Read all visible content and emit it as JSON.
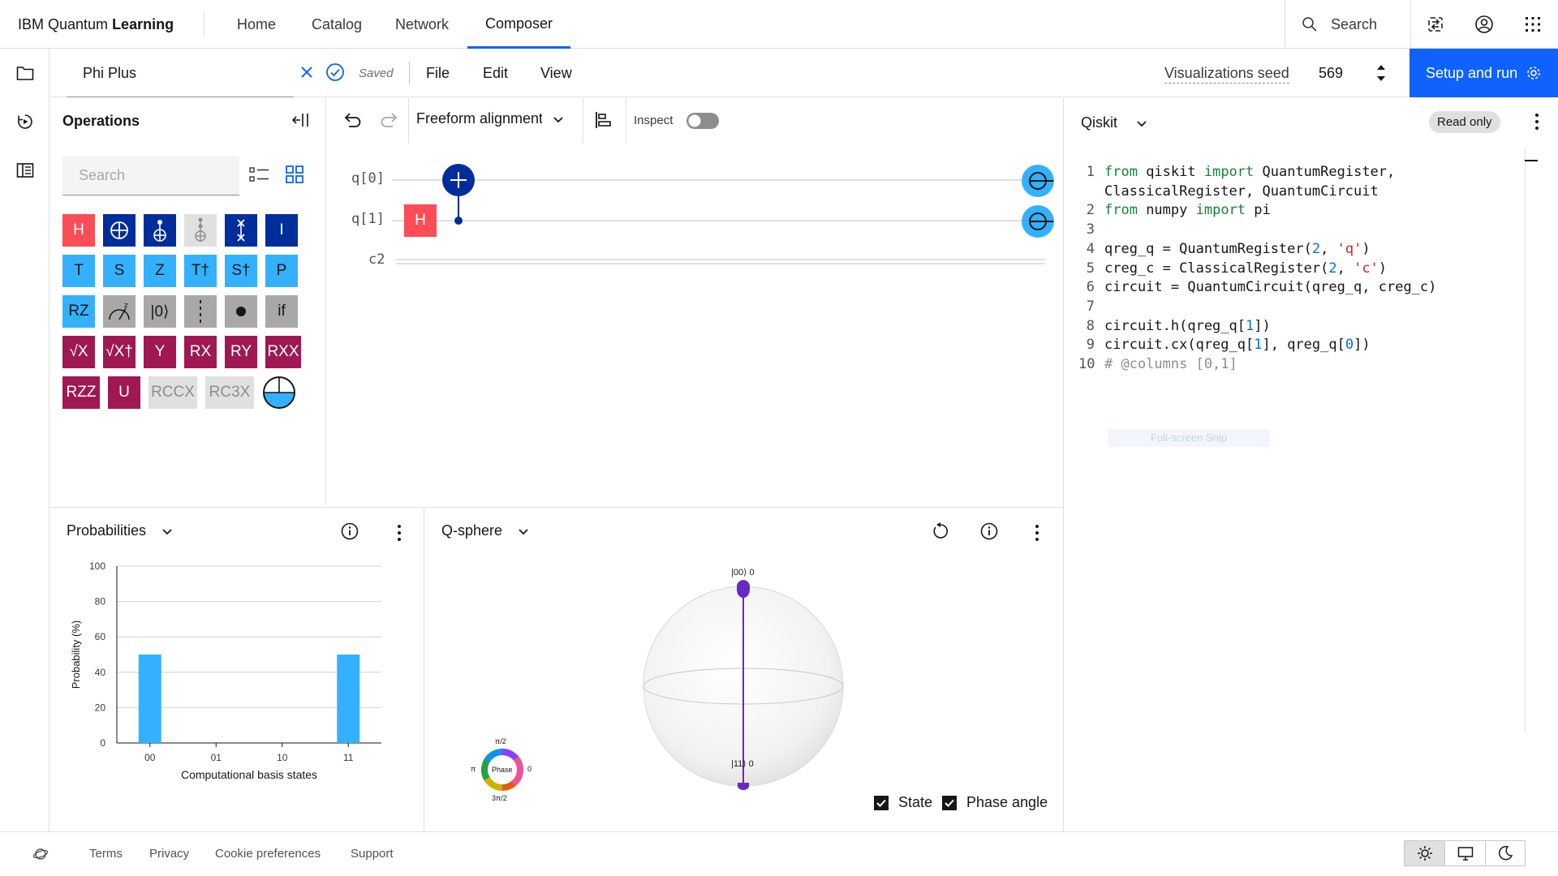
{
  "header": {
    "brand_prefix": "IBM Quantum",
    "brand_bold": "Learning",
    "nav": [
      "Home",
      "Catalog",
      "Network",
      "Composer"
    ],
    "active_nav": "Composer",
    "search_label": "Search"
  },
  "filebar": {
    "file_name": "Phi Plus",
    "saved_label": "Saved",
    "menus": [
      "File",
      "Edit",
      "View"
    ],
    "seed_label": "Visualizations seed",
    "seed_value": "569",
    "setup_button": "Setup and run"
  },
  "operations": {
    "title": "Operations",
    "search_placeholder": "Search",
    "gates_row1": [
      "H",
      "",
      "",
      "",
      "",
      "I"
    ],
    "gates_row2": [
      "T",
      "S",
      "Z",
      "T†",
      "S†",
      "P"
    ],
    "gates_row3": [
      "RZ",
      "",
      "|0⟩",
      "",
      "",
      "if"
    ],
    "gates_row4": [
      "√X",
      "√X†",
      "Y",
      "RX",
      "RY",
      "RXX"
    ],
    "gates_row5": [
      "RZZ",
      "U",
      "RCCX",
      "RC3X",
      ""
    ]
  },
  "circuit_toolbar": {
    "alignment": "Freeform alignment",
    "inspect_label": "Inspect",
    "inspect_on": false
  },
  "circuit": {
    "wires": [
      "q[0]",
      "q[1]",
      "c2"
    ],
    "gates": [
      {
        "type": "H",
        "qubit": 1,
        "column": 0
      },
      {
        "type": "CX",
        "control": 1,
        "target": 0,
        "column": 1
      }
    ]
  },
  "code": {
    "language": "Qiskit",
    "badge": "Read only",
    "ghost_text": "Full-screen Snip",
    "lines": [
      "from qiskit import QuantumRegister,",
      "ClassicalRegister, QuantumCircuit",
      "from numpy import pi",
      "",
      "qreg_q = QuantumRegister(2, 'q')",
      "creg_c = ClassicalRegister(2, 'c')",
      "circuit = QuantumCircuit(qreg_q, creg_c)",
      "",
      "circuit.h(qreg_q[1])",
      "circuit.cx(qreg_q[1], qreg_q[0])",
      "# @columns [0,1]"
    ],
    "line_numbers": [
      "1",
      "",
      "2",
      "3",
      "4",
      "5",
      "6",
      "7",
      "8",
      "9",
      "10"
    ]
  },
  "probabilities": {
    "title": "Probabilities"
  },
  "chart_data": {
    "type": "bar",
    "categories": [
      "00",
      "01",
      "10",
      "11"
    ],
    "values": [
      50,
      0,
      0,
      50
    ],
    "xlabel": "Computational basis states",
    "ylabel": "Probability (%)",
    "ylim": [
      0,
      100
    ],
    "yticks": [
      "0",
      "20",
      "40",
      "60",
      "80",
      "100"
    ],
    "grid": true,
    "color": "#33b1ff"
  },
  "qsphere": {
    "title": "Q-sphere",
    "top_state": "|00⟩ 0",
    "bottom_state": "|11⟩ 0",
    "phase_label": "Phase",
    "phase_top": "π/2",
    "phase_left": "π",
    "phase_right": "0",
    "phase_bottom": "3π/2",
    "state_checkbox": "State",
    "phase_checkbox": "Phase angle",
    "state_checked": true,
    "phase_checked": true
  },
  "footer": {
    "links": [
      "Terms",
      "Privacy",
      "Cookie preferences",
      "Support"
    ]
  },
  "colors": {
    "primary": "#0f62fe",
    "navy": "#002d9c",
    "red": "#fa4d56",
    "cyan": "#33b1ff",
    "magenta": "#9f1853",
    "purple": "#6929c4"
  }
}
